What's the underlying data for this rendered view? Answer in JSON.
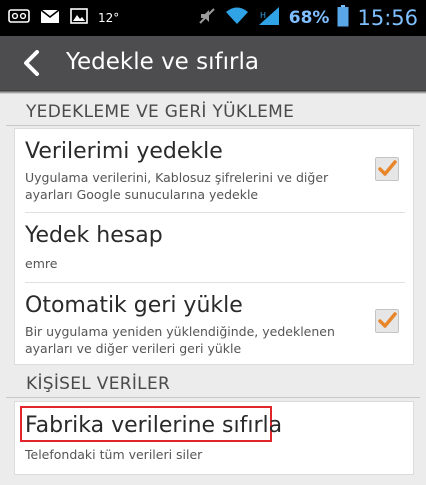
{
  "status_bar": {
    "icons_left": [
      "sim-card-icon",
      "mail-icon",
      "image-icon"
    ],
    "temperature": "12°",
    "battery_percent": "68%",
    "time": "15:56"
  },
  "action_bar": {
    "title": "Yedekle ve sıfırla"
  },
  "sections": [
    {
      "header": "YEDEKLEME VE GERİ YÜKLEME",
      "items": [
        {
          "title": "Verilerimi yedekle",
          "summary": "Uygulama verilerini, Kablosuz şifrelerini ve diğer ayarları Google sunucularına yedekle",
          "checked": true
        },
        {
          "title": "Yedek hesap",
          "summary": "emre"
        },
        {
          "title": "Otomatik geri yükle",
          "summary": "Bir uygulama yeniden yüklendiğinde, yedeklenen ayarları ve diğer verileri geri yükle",
          "checked": true
        }
      ]
    },
    {
      "header": "KİŞİSEL VERİLER",
      "items": [
        {
          "title": "Fabrika verilerine sıfırla",
          "summary": "Telefondaki tüm verileri siler"
        }
      ]
    }
  ],
  "colors": {
    "accent": "#e2242b",
    "check": "#e8862a",
    "status_blue": "#7fbfff",
    "action_bar": "#4d4d4f"
  }
}
